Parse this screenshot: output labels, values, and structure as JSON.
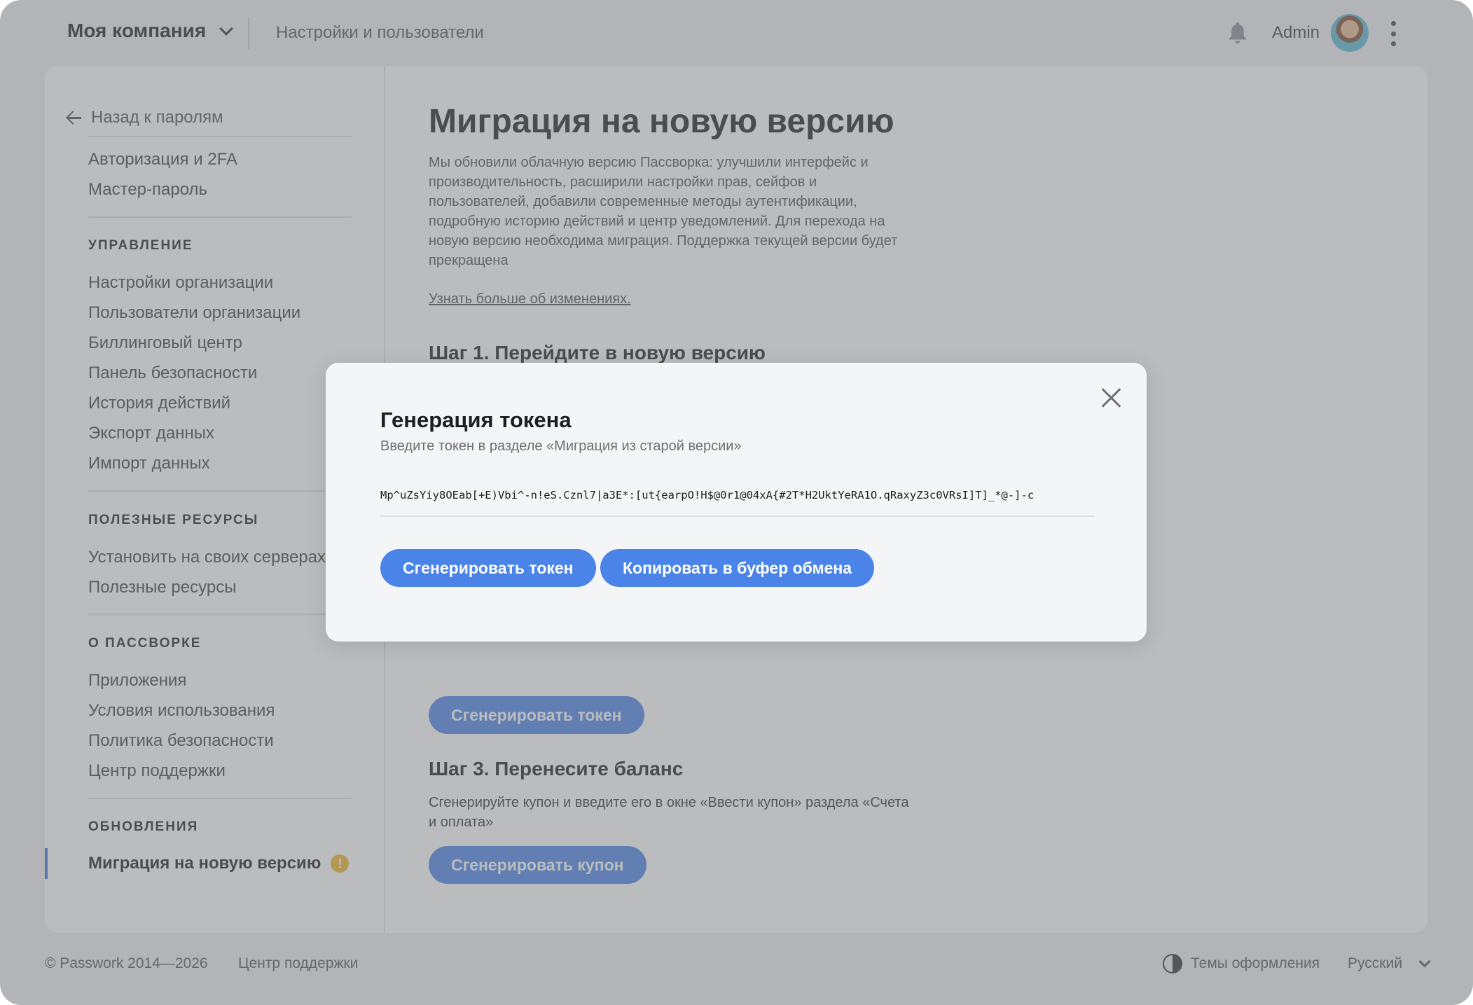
{
  "header": {
    "company": "Моя компания",
    "breadcrumb": "Настройки и пользователи",
    "user": "Admin"
  },
  "sidebar": {
    "back": "Назад к паролям",
    "top_items": [
      "Авторизация и 2FA",
      "Мастер-пароль"
    ],
    "sections": [
      {
        "title": "УПРАВЛЕНИЕ",
        "items": [
          "Настройки организации",
          "Пользователи организации",
          "Биллинговый центр",
          "Панель безопасности",
          "История действий",
          "Экспорт данных",
          "Импорт данных"
        ]
      },
      {
        "title": "ПОЛЕЗНЫЕ РЕСУРСЫ",
        "items": [
          "Установить на своих серверах",
          "Полезные ресурсы"
        ]
      },
      {
        "title": "О ПАССВОРКЕ",
        "items": [
          "Приложения",
          "Условия использования",
          "Политика безопасности",
          "Центр поддержки"
        ]
      },
      {
        "title": "ОБНОВЛЕНИЯ",
        "items": [
          "Миграция на новую версию"
        ]
      }
    ],
    "warning_glyph": "!"
  },
  "main": {
    "title": "Миграция на новую версию",
    "intro": "Мы обновили облачную версию Пассворка: улучшили интерфейс и производительность, расширили настройки прав, сейфов и пользователей, добавили современные методы аутентификации, подробную историю действий и центр уведомлений. Для перехода на новую версию необходима миграция. Поддержка текущей версии будет прекращена",
    "learn_more": "Узнать больше об изменениях.",
    "step1_title": "Шаг 1. Перейдите в новую версию",
    "step2_button": "Сгенерировать токен",
    "step3_title": "Шаг 3. Перенесите баланс",
    "step3_text": "Сгенерируйте купон и введите его в окне «Ввести купон» раздела «Счета и оплата»",
    "step3_button": "Сгенерировать купон"
  },
  "modal": {
    "title": "Генерация токена",
    "subtitle": "Введите токен в разделе «Миграция из старой версии»",
    "token": "Mp^uZsYiy8OEab[+E)Vbi^-n!eS.Cznl7|a3E*:[ut{earpO!H$@0r1@04xA{#2T*H2UktYeRA1O.qRaxyZ3c0VRsI]T]_*@-]-c",
    "generate_button": "Сгенерировать токен",
    "copy_button": "Копировать в буфер обмена"
  },
  "footer": {
    "copyright": "© Passwork 2014—2026",
    "support": "Центр поддержки",
    "themes": "Темы оформления",
    "language": "Русский"
  },
  "colors": {
    "accent": "#4a84e8",
    "active_indicator": "#3f6fd8",
    "warning": "#f0b429"
  }
}
